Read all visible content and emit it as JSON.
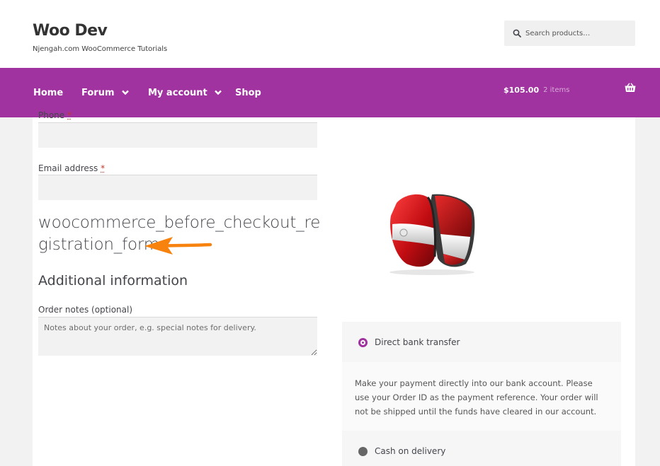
{
  "header": {
    "site_title": "Woo Dev",
    "tagline": "Njengah.com WooCommerce Tutorials",
    "search_placeholder": "Search products…"
  },
  "nav": {
    "items": [
      {
        "label": "Home",
        "has_dropdown": false
      },
      {
        "label": "Forum",
        "has_dropdown": true
      },
      {
        "label": "My account",
        "has_dropdown": true
      },
      {
        "label": "Shop",
        "has_dropdown": false
      }
    ],
    "cart_total": "$105.00",
    "cart_count": "2 items"
  },
  "form": {
    "phone_label": "Phone",
    "phone_required": "*",
    "email_label": "Email address",
    "email_required": "*",
    "hook_text": "woocommerce_before_checkout_registration_form",
    "additional_title": "Additional information",
    "order_notes_label": "Order notes (optional)",
    "order_notes_placeholder": "Notes about your order, e.g. special notes for delivery."
  },
  "payment": {
    "methods": [
      {
        "label": "Direct bank transfer",
        "selected": true
      },
      {
        "label": "Cash on delivery",
        "selected": false
      }
    ],
    "bank_description": "Make your payment directly into our bank account. Please use your Order ID as the payment reference. Your order will not be shipped until the funds have cleared in our account."
  },
  "colors": {
    "brand": "#a0339f",
    "arrow": "#f7820d"
  }
}
